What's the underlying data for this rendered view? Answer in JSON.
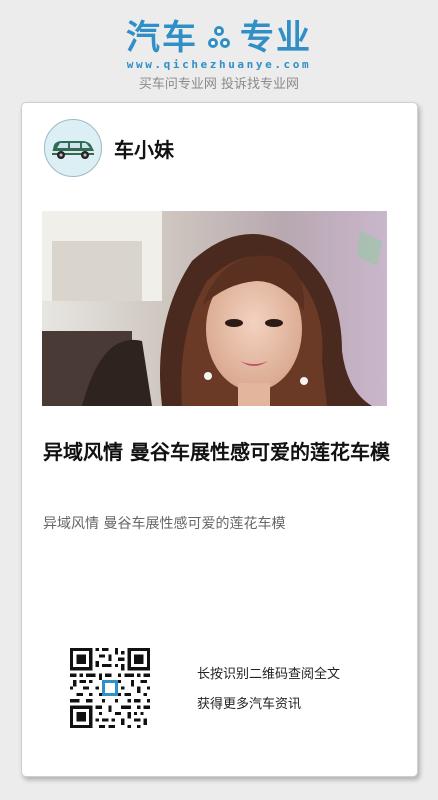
{
  "header": {
    "logo_left": "汽车",
    "logo_right": "专业",
    "logo_icon": "gear-icon",
    "url": "www.qichezhuanye.com",
    "slogan": "买车问专业网 投诉找专业网",
    "brand_color": "#2f8fc6"
  },
  "author": {
    "name": "车小妹",
    "avatar_icon": "car-icon"
  },
  "article": {
    "title": "异域风情  曼谷车展性感可爱的莲花车模",
    "summary": "异域风情  曼谷车展性感可爱的莲花车模"
  },
  "footer": {
    "qr_icon": "qr-code-icon",
    "line1": "长按识别二维码查阅全文",
    "line2": "获得更多汽车资讯"
  }
}
